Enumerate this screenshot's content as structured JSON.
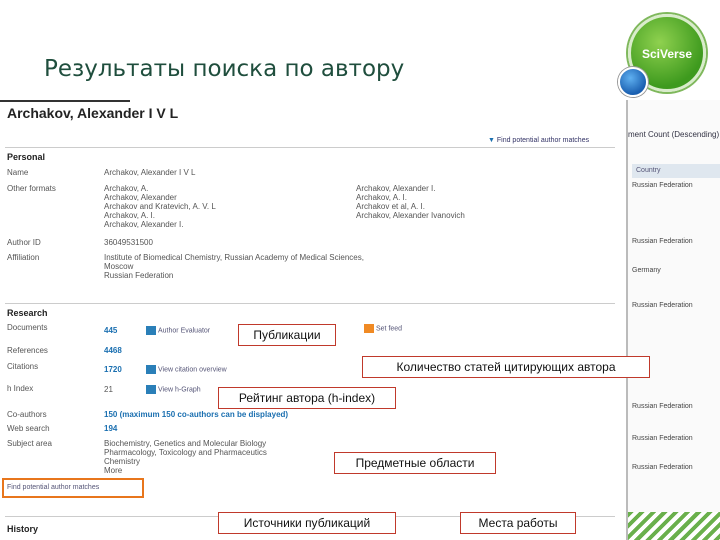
{
  "slide": {
    "title": "Результаты поиска по автору",
    "logo": "SciVerse"
  },
  "author": {
    "name": "Archakov, Alexander I V L",
    "find_matches": "Find potential author matches",
    "personal": {
      "heading": "Personal",
      "name_label": "Name",
      "name_value": "Archakov, Alexander I V L",
      "other_label": "Other formats",
      "other_left": [
        "Archakov, A.",
        "Archakov, Alexander",
        "Archakov and Kratevich, A. V. L",
        "Archakov, A. I.",
        "Archakov, Alexander I."
      ],
      "other_right": [
        "Archakov, Alexander I.",
        "Archakov, A. I.",
        "Archakov et al, A. I.",
        "Archakov, Alexander Ivanovich"
      ],
      "id_label": "Author ID",
      "id_value": "36049531500",
      "aff_label": "Affiliation",
      "aff_value": [
        "Institute of Biomedical Chemistry, Russian Academy of Medical Sciences,",
        "Moscow",
        "Russian Federation"
      ]
    },
    "research": {
      "heading": "Research",
      "documents_label": "Documents",
      "documents_value": "445",
      "evaluator": "Author Evaluator",
      "rss": "Set feed",
      "references_label": "References",
      "references_value": "4468",
      "citations_label": "Citations",
      "citations_value": "1720",
      "citation_overview": "View citation overview",
      "hindex_label": "h Index",
      "hindex_value": "21",
      "hgraph": "View h-Graph",
      "coauthors_label": "Co-authors",
      "coauthors_value": "150 (maximum 150 co-authors can be displayed)",
      "web_label": "Web search",
      "web_value": "194",
      "subject_label": "Subject area",
      "subject_value": [
        "Biochemistry, Genetics and Molecular Biology",
        "Pharmacology, Toxicology and Pharmaceutics",
        "Chemistry",
        "More"
      ]
    },
    "bottom_link": "Find potential author matches",
    "history_heading": "History"
  },
  "callouts": {
    "publications": "Публикации",
    "citing": "Количество статей цитирующих автора",
    "hindex": "Рейтинг автора (h-index)",
    "subjects": "Предметные области",
    "sources": "Источники публикаций",
    "workplaces": "Места работы"
  },
  "right_panel": {
    "top_text": "ment Count (Descending)",
    "header": "Country",
    "rows": [
      "Russian Federation",
      "Russian Federation",
      "Germany",
      "Russian Federation",
      "Russian Federation",
      "Russian Federation",
      "Russian Federation"
    ]
  },
  "colors": {
    "title": "#1f4e3d",
    "link": "#1a6fb0",
    "callout_border": "#c0392b",
    "highlight": "#e8761c"
  }
}
